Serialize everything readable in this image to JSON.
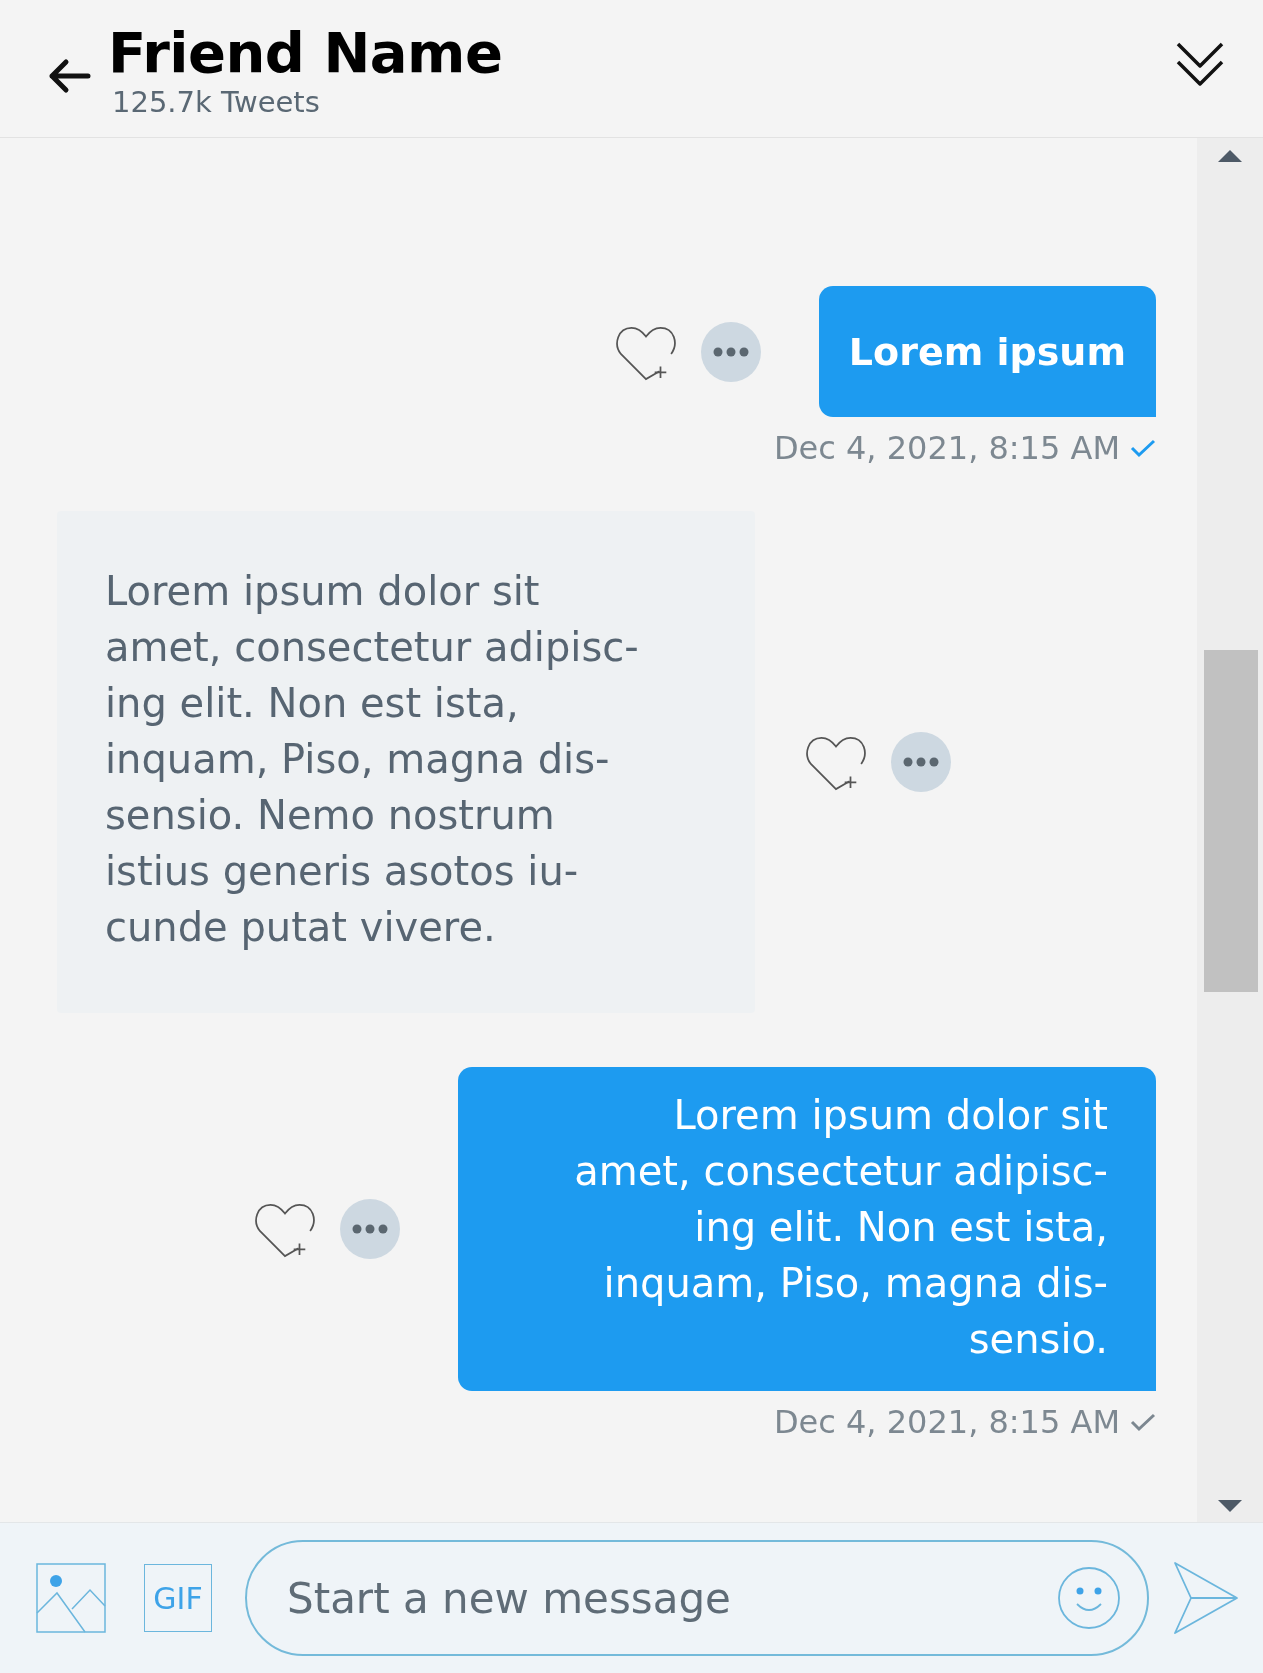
{
  "header": {
    "title": "Friend Name",
    "subtitle": "125.7k Tweets"
  },
  "messages": [
    {
      "kind": "sent",
      "lines": [
        "Lorem ipsum"
      ],
      "timestamp": "Dec 4, 2021, 8:15 AM",
      "read": true
    },
    {
      "kind": "received",
      "lines": [
        "Lorem ipsum dolor sit",
        "amet, consectetur adipisc-",
        "ing elit. Non est ista,",
        "inquam, Piso, magna dis-",
        "sensio. Nemo nostrum",
        "istius generis asotos iu-",
        "cunde putat vivere."
      ]
    },
    {
      "kind": "sent",
      "lines": [
        "Lorem ipsum dolor sit",
        "amet, consectetur adipisc-",
        "ing elit. Non est ista,",
        "inquam, Piso, magna dis-",
        "sensio."
      ],
      "timestamp": "Dec 4, 2021, 8:15 AM",
      "read": false
    }
  ],
  "composer": {
    "gif_label": "GIF",
    "placeholder": "Start a new message"
  }
}
